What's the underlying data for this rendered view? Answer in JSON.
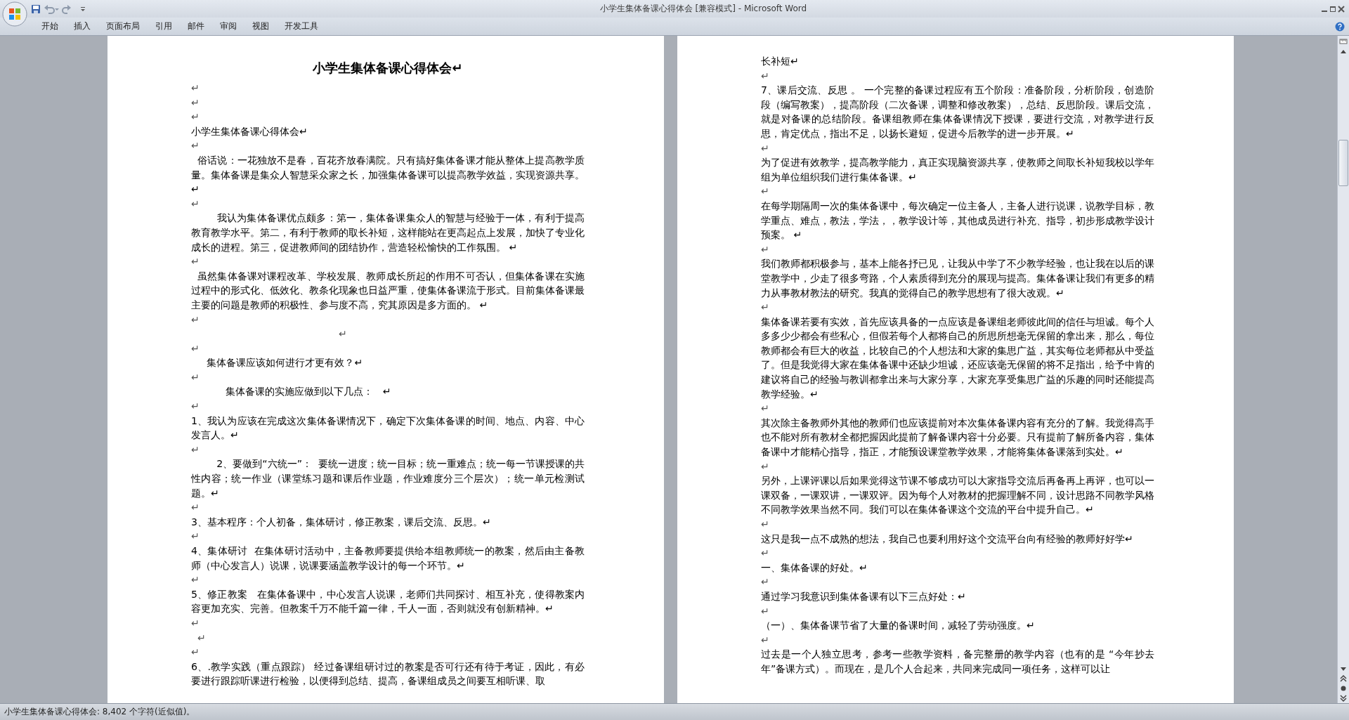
{
  "window": {
    "title": "小学生集体备课心得体会 [兼容模式] - Microsoft Word"
  },
  "ribbon_tabs": [
    {
      "label": "开始"
    },
    {
      "label": "插入"
    },
    {
      "label": "页面布局"
    },
    {
      "label": "引用"
    },
    {
      "label": "邮件"
    },
    {
      "label": "审阅"
    },
    {
      "label": "视图"
    },
    {
      "label": "开发工具"
    }
  ],
  "pages": [
    {
      "paragraphs": [
        {
          "kind": "title",
          "text": "小学生集体备课心得体会↵"
        },
        {
          "kind": "mark",
          "text": "↵"
        },
        {
          "kind": "mark",
          "text": "↵"
        },
        {
          "kind": "mark",
          "text": "↵"
        },
        {
          "kind": "body",
          "text": "小学生集体备课心得体会↵"
        },
        {
          "kind": "mark",
          "text": "↵"
        },
        {
          "kind": "body",
          "text": "  俗话说：一花独放不是春，百花齐放春满院。只有搞好集体备课才能从整体上提高教学质量。集体备课是集众人智慧采众家之长，加强集体备课可以提高教学效益，实现资源共享。 ↵"
        },
        {
          "kind": "mark",
          "text": "↵"
        },
        {
          "kind": "body",
          "text": "        我认为集体备课优点颇多：第一，集体备课集众人的智慧与经验于一体，有利于提高教育教学水平。第二，有利于教师的取长补短，这样能站在更高起点上发展，加快了专业化成长的进程。第三，促进教师间的团结协作，营造轻松愉快的工作氛围。 ↵"
        },
        {
          "kind": "mark",
          "text": "↵"
        },
        {
          "kind": "body",
          "text": "  虽然集体备课对课程改革、学校发展、教师成长所起的作用不可否认，但集体备课在实施过程中的形式化、低效化、教条化现象也日益严重，使集体备课流于形式。目前集体备课最主要的问题是教师的积极性、参与度不高，究其原因是多方面的。 ↵"
        },
        {
          "kind": "mark",
          "text": "↵"
        },
        {
          "kind": "mark",
          "text": "　　　　　　　　　　　　　　　↵"
        },
        {
          "kind": "mark",
          "text": "↵"
        },
        {
          "kind": "body",
          "text": "     集体备课应该如何进行才更有效？↵"
        },
        {
          "kind": "mark",
          "text": "↵"
        },
        {
          "kind": "body",
          "text": "           集体备课的实施应做到以下几点：   ↵"
        },
        {
          "kind": "mark",
          "text": "↵"
        },
        {
          "kind": "body",
          "text": "1、我认为应该在完成这次集体备课情况下，确定下次集体备课的时间、地点、内容、中心发言人。↵"
        },
        {
          "kind": "mark",
          "text": "↵"
        },
        {
          "kind": "body",
          "text": "        2、要做到“六统一”：  要统一进度；统一目标；统一重难点；统一每一节课授课的共性内容；统一作业（课堂练习题和课后作业题，作业难度分三个层次）；统一单元检测试题。↵"
        },
        {
          "kind": "mark",
          "text": "↵"
        },
        {
          "kind": "body",
          "text": "3、基本程序：个人初备，集体研讨，修正教案，课后交流、反思。↵"
        },
        {
          "kind": "mark",
          "text": "↵"
        },
        {
          "kind": "body",
          "text": "4、集体研讨  在集体研讨活动中，主备教师要提供给本组教师统一的教案，然后由主备教师（中心发言人）说课，说课要涵盖教学设计的每一个环节。↵"
        },
        {
          "kind": "mark",
          "text": "↵"
        },
        {
          "kind": "body",
          "text": "5、修正教案   在集体备课中，中心发言人说课，老师们共同探讨、相互补充，使得教案内容更加充实、完善。但教案千万不能千篇一律，千人一面，否则就没有创新精神。↵"
        },
        {
          "kind": "mark",
          "text": "↵"
        },
        {
          "kind": "mark",
          "text": "  ↵"
        },
        {
          "kind": "mark",
          "text": "↵"
        },
        {
          "kind": "body",
          "text": "6、.教学实践（重点跟踪） 经过备课组研讨过的教案是否可行还有待于考证，因此，有必要进行跟踪听课进行检验，以便得到总结、提高，备课组成员之间要互相听课、取"
        }
      ]
    },
    {
      "paragraphs": [
        {
          "kind": "body",
          "text": "长补短↵"
        },
        {
          "kind": "mark",
          "text": "↵"
        },
        {
          "kind": "body",
          "text": "7、课后交流、反思 。 一个完整的备课过程应有五个阶段：准备阶段，分析阶段，创造阶段（编写教案），提高阶段（二次备课，调整和修改教案），总结、反思阶段。课后交流，就是对备课的总结阶段。备课组教师在集体备课情况下授课，要进行交流，对教学进行反思，肯定优点，指出不足，以扬长避短，促进今后教学的进一步开展。↵"
        },
        {
          "kind": "mark",
          "text": "↵"
        },
        {
          "kind": "body",
          "text": "为了促进有效教学，提高教学能力，真正实现脑资源共享，使教师之间取长补短我校以学年组为单位组织我们进行集体备课。↵"
        },
        {
          "kind": "mark",
          "text": "↵"
        },
        {
          "kind": "body",
          "text": "在每学期隔周一次的集体备课中，每次确定一位主备人，主备人进行说课，说教学目标，教学重点、难点，教法，学法，，教学设计等，其他成员进行补充、指导，初步形成教学设计预案。 ↵"
        },
        {
          "kind": "mark",
          "text": "↵"
        },
        {
          "kind": "body",
          "text": "我们教师都积极参与，基本上能各抒已见，让我从中学了不少教学经验，也让我在以后的课堂教学中，少走了很多弯路，个人素质得到充分的展现与提高。集体备课让我们有更多的精力从事教材教法的研究。我真的觉得自己的教学思想有了很大改观。↵"
        },
        {
          "kind": "mark",
          "text": "↵"
        },
        {
          "kind": "body",
          "text": "集体备课若要有实效，首先应该具备的一点应该是备课组老师彼此间的信任与坦诚。每个人多多少少都会有些私心，但假若每个人都将自己的所思所想毫无保留的拿出来，那么，每位教师都会有巨大的收益，比较自己的个人想法和大家的集思广益，其实每位老师都从中受益了。但是我觉得大家在集体备课中还缺少坦诚，还应该毫无保留的将不足指出，给予中肯的建议将自己的经验与教训都拿出来与大家分享，大家充享受集思广益的乐趣的同时还能提高教学经验。↵"
        },
        {
          "kind": "mark",
          "text": "↵"
        },
        {
          "kind": "body",
          "text": "其次除主备教师外其他的教师们也应该提前对本次集体备课内容有充分的了解。我觉得高手也不能对所有教材全都把握因此提前了解备课内容十分必要。只有提前了解所备内容，集体备课中才能精心指导，指正，才能预设课堂教学效果，才能将集体备课落到实处。↵"
        },
        {
          "kind": "mark",
          "text": "↵"
        },
        {
          "kind": "body",
          "text": "另外，上课评课以后如果觉得这节课不够成功可以大家指导交流后再备再上再评，也可以一课双备，一课双讲，一课双评。因为每个人对教材的把握理解不同，设计思路不同教学风格不同教学效果当然不同。我们可以在集体备课这个交流的平台中提升自己。↵"
        },
        {
          "kind": "mark",
          "text": "↵"
        },
        {
          "kind": "body",
          "text": "这只是我一点不成熟的想法，我自己也要利用好这个交流平台向有经验的教师好好学↵"
        },
        {
          "kind": "mark",
          "text": "↵"
        },
        {
          "kind": "body",
          "text": "一、集体备课的好处。↵"
        },
        {
          "kind": "mark",
          "text": "↵"
        },
        {
          "kind": "body",
          "text": "通过学习我意识到集体备课有以下三点好处：↵"
        },
        {
          "kind": "mark",
          "text": "↵"
        },
        {
          "kind": "body",
          "text": "（一）、集体备课节省了大量的备课时间，减轻了劳动强度。↵"
        },
        {
          "kind": "mark",
          "text": "↵"
        },
        {
          "kind": "body",
          "text": "过去是一个人独立思考，参考一些教学资料，备完整册的教学内容（也有的是 “今年抄去年”备课方式）。而现在，是几个人合起来，共同来完成同一项任务，这样可以让"
        }
      ]
    }
  ],
  "status_bar": {
    "text": "小学生集体备课心得体会: 8,402 个字符(近似值)。"
  }
}
